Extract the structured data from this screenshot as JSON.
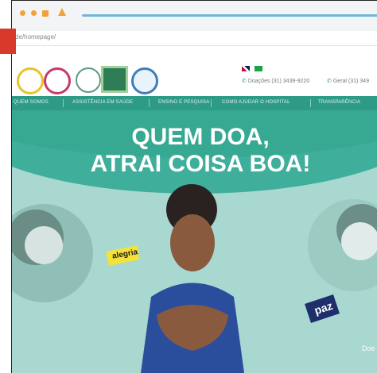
{
  "browser": {
    "url": "de/homepage/"
  },
  "header": {
    "logos": [
      "logo-badge-yellow",
      "logo-badge-pink",
      "logo-doar",
      "logo-green-seal",
      "logo-blue-seal"
    ],
    "languages": [
      "en-flag",
      "br-flag"
    ],
    "phone_donations": "Doações (31) 3439-9220",
    "phone_general": "Geral (31) 349"
  },
  "nav": {
    "items": [
      "QUEM SOMOS",
      "ASSISTÊNCIA EM SAÚDE",
      "ENSINO E PESQUISA",
      "COMO AJUDAR O HOSPITAL",
      "TRANSPARÊNCIA"
    ]
  },
  "hero": {
    "headline_line1": "QUEM DOA,",
    "headline_line2": "ATRAI COISA BOA!",
    "tag_left": "alegria",
    "tag_right": "paz",
    "cta": "Doe"
  },
  "colors": {
    "accent_teal": "#2e9b86",
    "hero_bg": "#a8d8cf",
    "tag_yellow": "#f4e23a",
    "tag_navy": "#1f2f6b",
    "red_marker": "#d9392b"
  }
}
